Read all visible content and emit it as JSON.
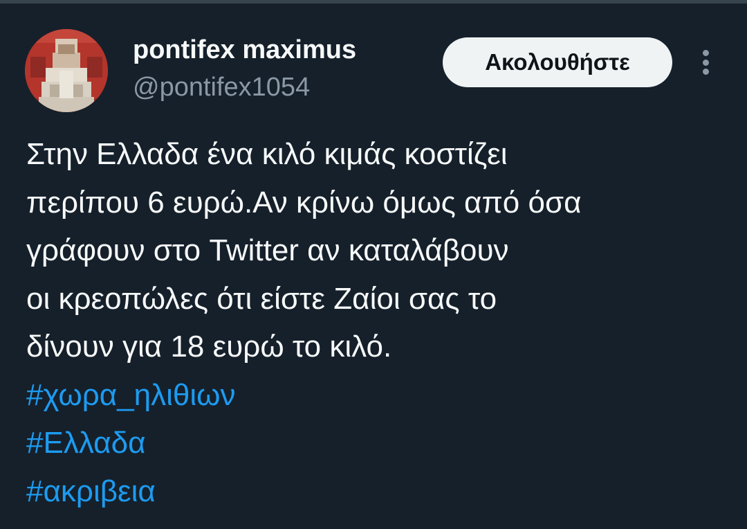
{
  "tweet": {
    "author": {
      "display_name": "pontifex maximus",
      "handle": "@pontifex1054",
      "avatar_icon": "pixelated-avatar-icon"
    },
    "follow_label": "Ακολουθήστε",
    "more_icon": "more-vertical-icon",
    "text_lines": [
      "Στην Ελλαδα ένα κιλό κιμάς κοστίζει",
      "περίπου 6 ευρώ.Αν κρίνω όμως από όσα",
      "γράφουν στο Twitter αν καταλάβουν",
      "οι κρεοπώλες ότι είστε Ζαίοι σας το",
      "δίνουν για 18 ευρώ το κιλό."
    ],
    "hashtags": [
      "#χωρα_ηλιθιων",
      "#Ελλαδα",
      "#ακριβεια"
    ]
  },
  "colors": {
    "background": "#15202b",
    "primary_text": "#f7f9f9",
    "secondary_text": "#8b98a5",
    "link": "#1d9bf0",
    "follow_button_bg": "#eff3f4",
    "follow_button_text": "#0f1419"
  }
}
